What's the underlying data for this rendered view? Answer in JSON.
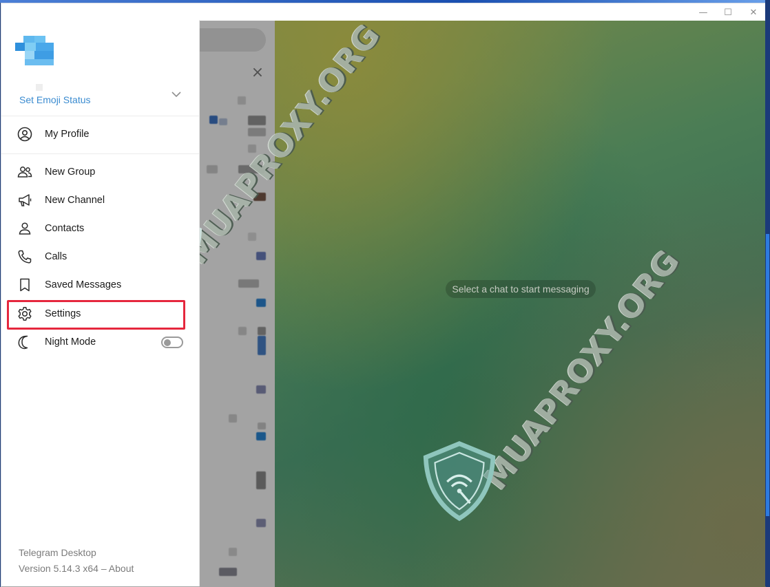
{
  "window": {
    "controls": {
      "minimize": "—",
      "maximize": "☐",
      "close": "✕"
    }
  },
  "sidebar": {
    "emoji_status_label": "Set Emoji Status",
    "menu": [
      {
        "id": "my-profile",
        "label": "My Profile",
        "icon": "profile-icon"
      },
      {
        "id": "new-group",
        "label": "New Group",
        "icon": "group-icon"
      },
      {
        "id": "new-channel",
        "label": "New Channel",
        "icon": "megaphone-icon"
      },
      {
        "id": "contacts",
        "label": "Contacts",
        "icon": "contact-icon"
      },
      {
        "id": "calls",
        "label": "Calls",
        "icon": "phone-icon"
      },
      {
        "id": "saved-messages",
        "label": "Saved Messages",
        "icon": "bookmark-icon"
      },
      {
        "id": "settings",
        "label": "Settings",
        "icon": "gear-icon",
        "highlighted": true
      },
      {
        "id": "night-mode",
        "label": "Night Mode",
        "icon": "moon-icon",
        "toggle": false
      }
    ],
    "footer": {
      "app_name": "Telegram Desktop",
      "version": "Version 5.14.3 x64",
      "separator": " – ",
      "about_link": "About"
    }
  },
  "chat_area": {
    "empty_message": "Select a chat to start messaging"
  },
  "watermark": {
    "text": "MUAPROXY.ORG"
  },
  "colors": {
    "accent": "#3a8bd0",
    "highlight": "#e5273d",
    "sidebar_bg": "#ffffff"
  }
}
